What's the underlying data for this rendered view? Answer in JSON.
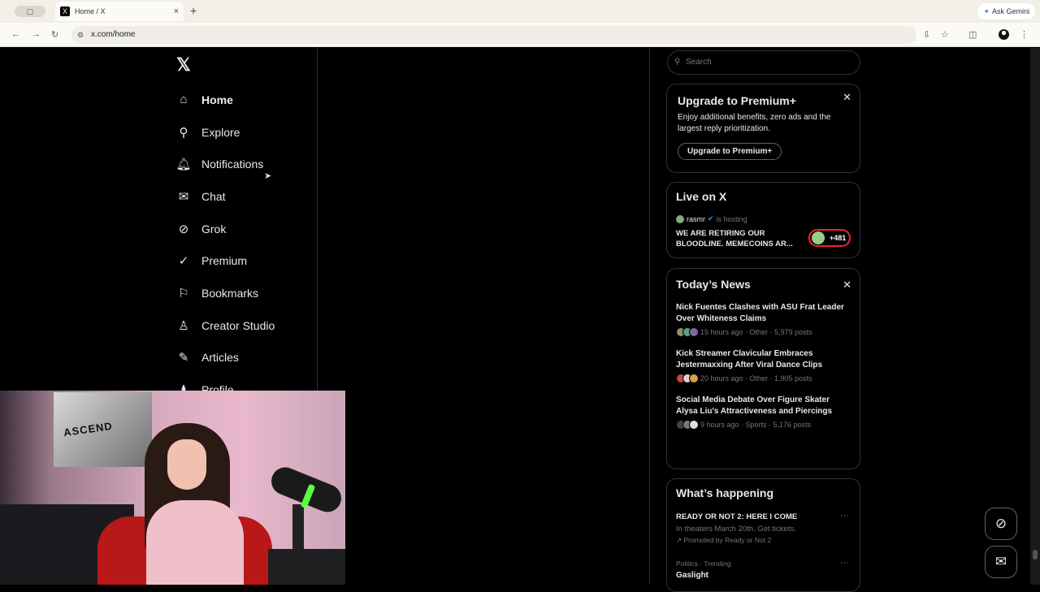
{
  "browser": {
    "tab_title": "Home / X",
    "tab_favicon": "X",
    "new_tab": "+",
    "tab_close": "×",
    "ask_gemini": "Ask Gemini",
    "url": "x.com/home"
  },
  "sidebar": {
    "logo": "𝕏",
    "items": [
      {
        "label": "Home",
        "icon": "home-icon"
      },
      {
        "label": "Explore",
        "icon": "search-icon"
      },
      {
        "label": "Notifications",
        "icon": "bell-icon"
      },
      {
        "label": "Chat",
        "icon": "mail-icon"
      },
      {
        "label": "Grok",
        "icon": "grok-icon"
      },
      {
        "label": "Premium",
        "icon": "premium-icon"
      },
      {
        "label": "Bookmarks",
        "icon": "bookmark-icon"
      },
      {
        "label": "Creator Studio",
        "icon": "creator-studio-icon"
      },
      {
        "label": "Articles",
        "icon": "article-icon"
      },
      {
        "label": "Profile",
        "icon": "profile-icon"
      }
    ]
  },
  "search": {
    "placeholder": "Search"
  },
  "premium_card": {
    "title": "Upgrade to Premium+",
    "body": "Enjoy additional benefits, zero ads and the largest reply prioritization.",
    "button": "Upgrade to Premium+"
  },
  "live": {
    "title": "Live on X",
    "host": "rasmr",
    "hosting": "is hosting",
    "space_title": "WE ARE RETIRING OUR BLOODLINE. MEMECOINS AR...",
    "count": "+481"
  },
  "news": {
    "title": "Today’s News",
    "items": [
      {
        "title": "Nick Fuentes Clashes with ASU Frat Leader Over Whiteness Claims",
        "meta": "15 hours ago · Other · 5,979 posts"
      },
      {
        "title": "Kick Streamer Clavicular Embraces Jestermaxxing After Viral Dance Clips",
        "meta": "20 hours ago · Other · 1,905 posts"
      },
      {
        "title": "Social Media Debate Over Figure Skater Alysa Liu's Attractiveness and Piercings",
        "meta": "9 hours ago · Sports · 5,176 posts"
      }
    ]
  },
  "happening": {
    "title": "What’s happening",
    "promo": {
      "title": "READY OR NOT 2: HERE I COME",
      "subtitle": "In theaters March 20th. Get tickets.",
      "promoted": "Promoted by Ready or Not 2"
    },
    "trend": {
      "category": "Politics · Trending",
      "title": "Gaslight"
    }
  },
  "webcam": {
    "poster_text": "ASCEND"
  },
  "colors": {
    "background": "#000000",
    "text": "#e7e9ea",
    "muted": "#71767b",
    "border": "#2f3336",
    "live_red": "#f4212e",
    "verified": "#1d9bf0"
  }
}
